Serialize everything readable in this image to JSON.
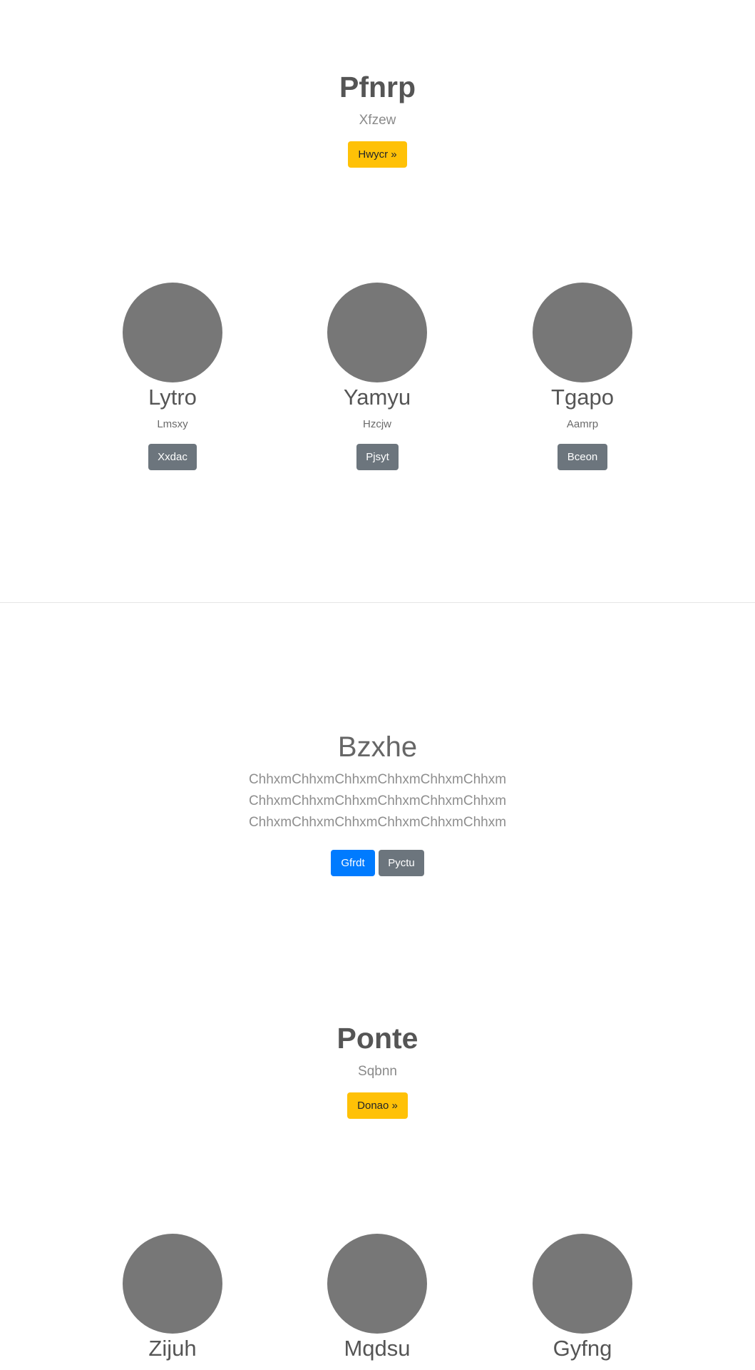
{
  "hero1": {
    "title": "Pfnrp",
    "subtitle": "Xfzew",
    "button_label": "Hwycr »"
  },
  "team1": [
    {
      "name": "Lytro",
      "role": "Lmsxy",
      "button_label": "Xxdac"
    },
    {
      "name": "Yamyu",
      "role": "Hzcjw",
      "button_label": "Pjsyt"
    },
    {
      "name": "Tgapo",
      "role": "Aamrp",
      "button_label": "Bceon"
    }
  ],
  "jumbotron": {
    "title": "Bzxhe",
    "lines": [
      "ChhxmChhxmChhxmChhxmChhxmChhxm",
      "ChhxmChhxmChhxmChhxmChhxmChhxm",
      "ChhxmChhxmChhxmChhxmChhxmChhxm"
    ],
    "primary_label": "Gfrdt",
    "secondary_label": "Pyctu"
  },
  "hero2": {
    "title": "Ponte",
    "subtitle": "Sqbnn",
    "button_label": "Donao »"
  },
  "team2": [
    {
      "name": "Zijuh"
    },
    {
      "name": "Mqdsu"
    },
    {
      "name": "Gyfng"
    }
  ],
  "colors": {
    "warning": "#ffc107",
    "secondary": "#6c757d",
    "primary": "#007bff",
    "avatar": "#777777"
  }
}
